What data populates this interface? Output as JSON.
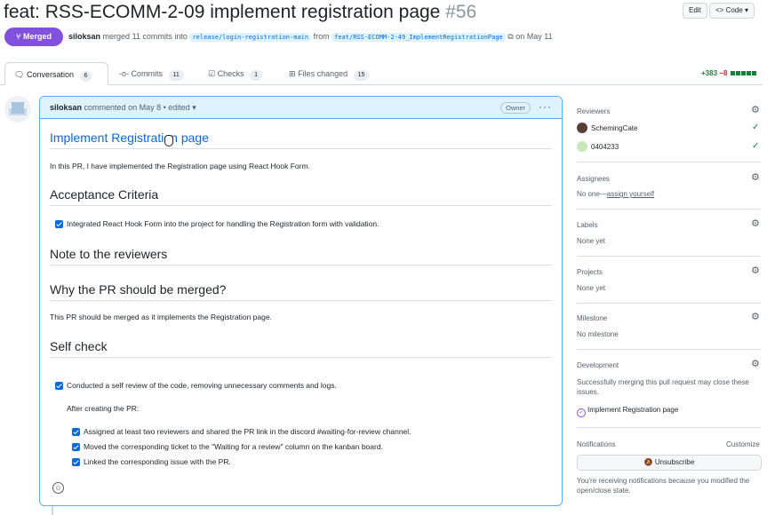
{
  "header": {
    "title": "feat: RSS-ECOMM-2-09 implement registration page",
    "number": "#56",
    "edit_label": "Edit",
    "code_label": "Code",
    "status_badge": "Merged",
    "meta": {
      "author": "siloksan",
      "merged_text": "merged 11 commits into",
      "base_branch": "release/login-registration-main",
      "from_text": "from",
      "head_branch": "feat/RSS-ECOMM-2-49_ImplementRegistrationPage",
      "date_text": "on May 11"
    }
  },
  "tabs": [
    {
      "label": "Conversation",
      "count": "6"
    },
    {
      "label": "Commits",
      "count": "11"
    },
    {
      "label": "Checks",
      "count": "1"
    },
    {
      "label": "Files changed",
      "count": "15"
    }
  ],
  "diffstat": {
    "additions": "+383",
    "deletions": "−8"
  },
  "comment": {
    "author": "siloksan",
    "meta": "commented on May 8 • edited",
    "badge": "Owner",
    "heading_link": "Implement Registration page",
    "intro": "In this PR, I have implemented the Registration page using React Hook Form.",
    "h_acceptance": "Acceptance Criteria",
    "acceptance_item": "Integrated React Hook Form into the project for handling the Registration form with validation.",
    "h_note": "Note to the reviewers",
    "h_why": "Why the PR should be merged?",
    "why_text": "This PR should be merged as it implements the Registration page.",
    "h_self": "Self check",
    "self_item": "Conducted a self review of the code, removing unnecessary comments and logs.",
    "after_pr": "After creating the PR:",
    "sub_items": [
      "Assigned at least two reviewers and shared the PR link in the discord #waiting-for-review channel.",
      "Moved the corresponding ticket to the \"Waiting for a review\" column on the kanban board.",
      "Linked the corresponding issue with the PR."
    ]
  },
  "sidebar": {
    "reviewers_label": "Reviewers",
    "reviewers": [
      {
        "name": "SchemingCate",
        "avatar_color": "#5a3e36"
      },
      {
        "name": "0404233",
        "avatar_color": "#c9e7b8"
      }
    ],
    "assignees_label": "Assignees",
    "assignees_none": "No one—",
    "assign_yourself": "assign yourself",
    "labels_label": "Labels",
    "labels_value": "None yet",
    "projects_label": "Projects",
    "projects_value": "None yet",
    "milestone_label": "Milestone",
    "milestone_value": "No milestone",
    "development_label": "Development",
    "development_text": "Successfully merging this pull request may close these issues.",
    "development_item": "Implement Registration page",
    "notifications_label": "Notifications",
    "customize_label": "Customize",
    "unsubscribe_label": "Unsubscribe",
    "notif_reason": "You're receiving notifications because you modified the open/close state."
  },
  "colors": {
    "merged": "#8250df",
    "link": "#0969da",
    "add": "#1a7f37",
    "del": "#cf222e",
    "comment_header": "#ddf4ff"
  }
}
